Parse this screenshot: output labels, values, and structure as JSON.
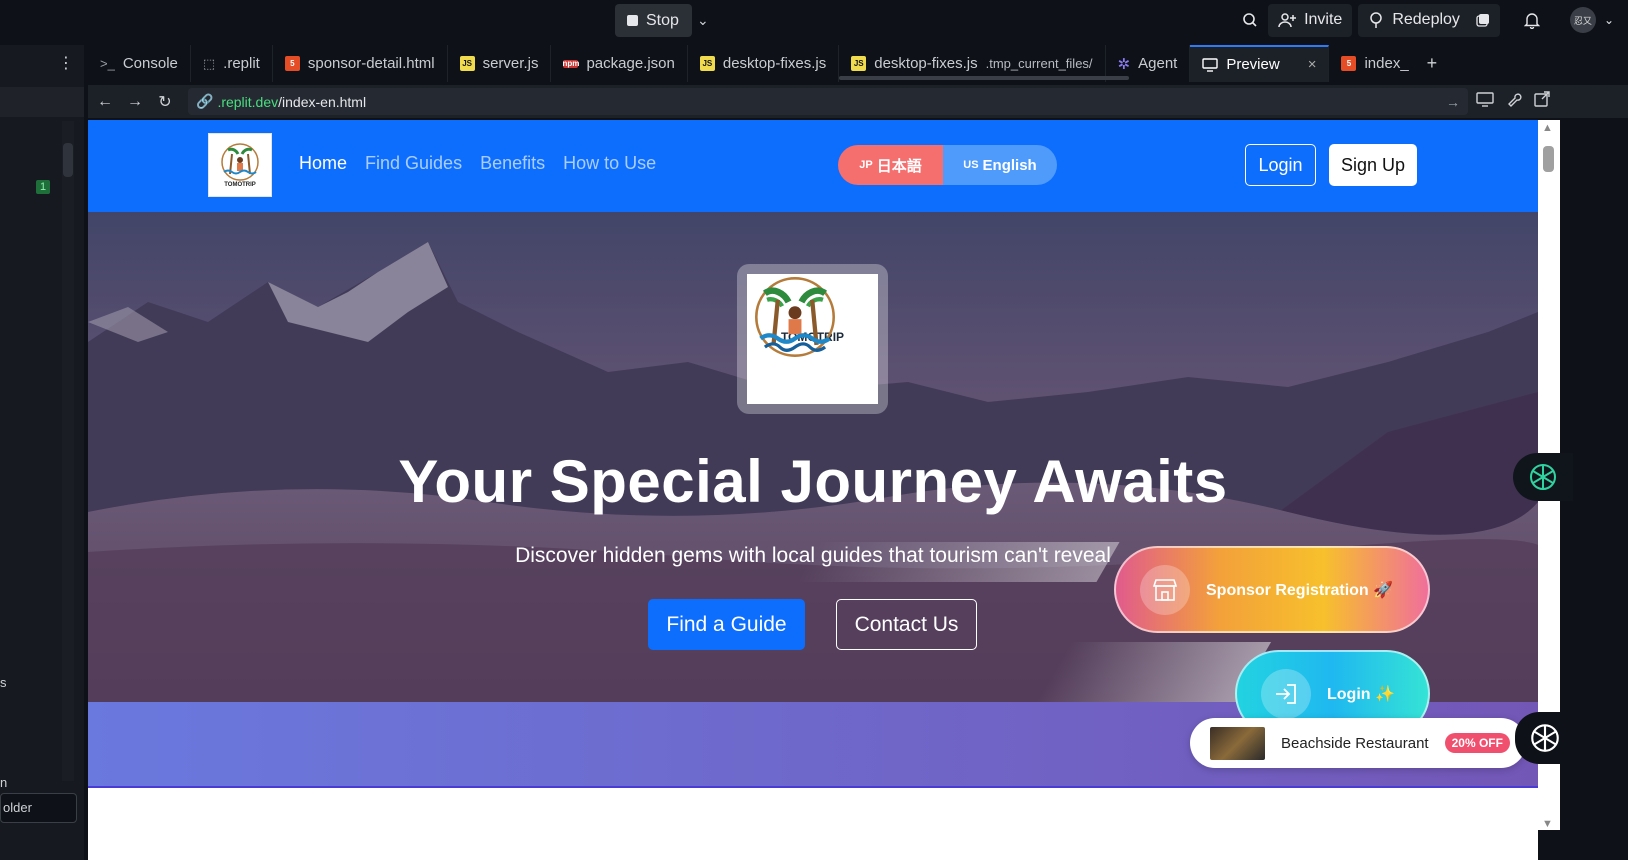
{
  "topbar": {
    "stop_label": "Stop",
    "invite_label": "Invite",
    "redeploy_label": "Redeploy",
    "avatar_text": "忍又"
  },
  "tabs": [
    {
      "label": "Console",
      "icon": "terminal-icon"
    },
    {
      "label": ".replit",
      "icon": "replit-file-icon"
    },
    {
      "label": "sponsor-detail.html",
      "icon": "html-file-icon"
    },
    {
      "label": "server.js",
      "icon": "js-file-icon"
    },
    {
      "label": "package.json",
      "icon": "json-file-icon"
    },
    {
      "label": "desktop-fixes.js",
      "icon": "js-file-icon"
    },
    {
      "label": "desktop-fixes.js",
      "icon": "js-file-icon",
      "suffix": ".tmp_current_files/"
    },
    {
      "label": "Agent",
      "icon": "agent-icon"
    },
    {
      "label": "Preview",
      "icon": "monitor-icon",
      "active": true
    },
    {
      "label": "index_",
      "icon": "html-file-icon"
    }
  ],
  "url": {
    "host": ".replit.dev",
    "path": "/index-en.html"
  },
  "left_panel": {
    "badge": "1",
    "text_s": "s",
    "text_n": "n",
    "folder_input": "older"
  },
  "site": {
    "logo_text": "TOMOTRIP",
    "nav": [
      "Home",
      "Find Guides",
      "Benefits",
      "How to Use"
    ],
    "lang_jp_flag": "JP",
    "lang_jp": "日本語",
    "lang_en_flag": "US",
    "lang_en": "English",
    "login": "Login",
    "signup": "Sign Up"
  },
  "hero": {
    "logo_text": "TOMOTRIP",
    "title": "Your Special Journey Awaits",
    "subtitle": "Discover hidden gems with local guides that tourism can't reveal",
    "find_btn": "Find a Guide",
    "contact_btn": "Contact Us"
  },
  "floating": {
    "sponsor_label": "Sponsor Registration 🚀",
    "login_label": "Login ✨"
  },
  "promo": {
    "name": "Beachside Restaurant",
    "badge": "20% OFF"
  },
  "colors": {
    "nav_blue": "#0d6efd",
    "lang_jp": "#f56f6f",
    "lang_en": "#4e9bfb",
    "accent_green": "#4ade80"
  }
}
